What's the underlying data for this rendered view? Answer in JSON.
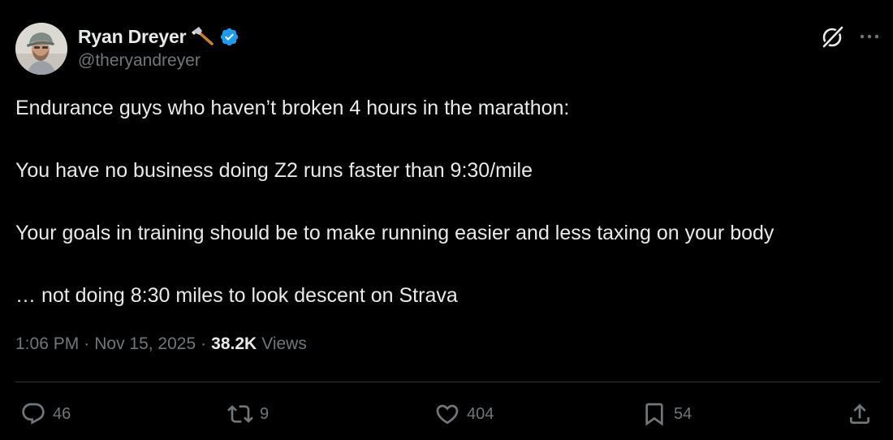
{
  "author": {
    "name": "Ryan Dreyer",
    "handle": "@theryandreyer",
    "emoji_icon": "axe-icon",
    "verified_icon": "verified-badge-icon"
  },
  "header_actions": {
    "grok_icon": "grok-icon",
    "more_icon": "more-dots-icon"
  },
  "tweet": {
    "lines": [
      "Endurance guys who haven’t broken 4 hours in the marathon:",
      "",
      "You have no business doing Z2 runs faster than 9:30/mile",
      "",
      "Your goals in training should be to make running easier and less taxing on your body",
      "",
      "… not doing 8:30 miles to look descent on Strava"
    ]
  },
  "meta": {
    "time": "1:06 PM",
    "separator": "·",
    "date": "Nov 15, 2025",
    "views_count": "38.2K",
    "views_label": "Views"
  },
  "actions": {
    "replies": "46",
    "reposts": "9",
    "likes": "404",
    "bookmarks": "54"
  },
  "colors": {
    "background": "#000000",
    "primary_text": "#e7e9ea",
    "secondary_text": "#71767b",
    "divider": "#2f3336",
    "verified": "#1d9bf0"
  }
}
